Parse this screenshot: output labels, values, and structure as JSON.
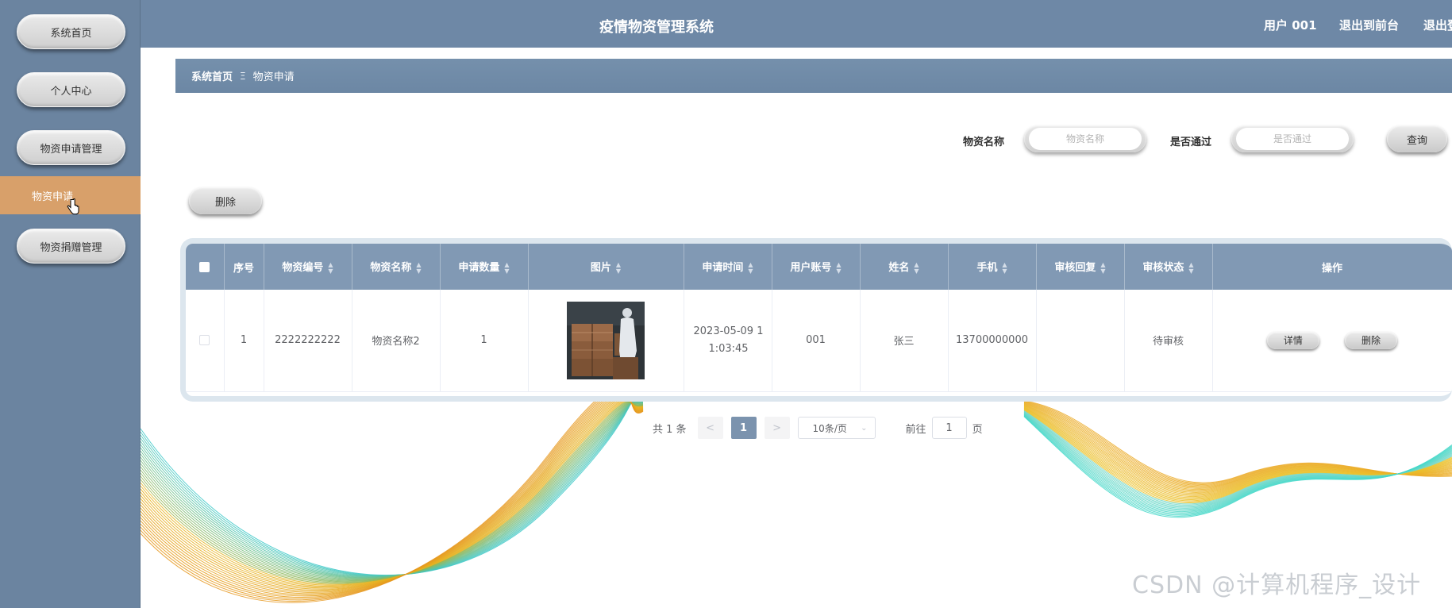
{
  "sidebar": {
    "items": [
      {
        "label": "系统首页"
      },
      {
        "label": "个人中心"
      },
      {
        "label": "物资申请管理"
      },
      {
        "label": "物资申请"
      },
      {
        "label": "物资捐赠管理"
      }
    ]
  },
  "header": {
    "title": "疫情物资管理系统",
    "user": "用户 001",
    "back_to_front": "退出到前台",
    "exit": "退出登录"
  },
  "breadcrumb": {
    "home": "系统首页",
    "separator": "Ξ",
    "current": "物资申请"
  },
  "search": {
    "name_label": "物资名称",
    "name_placeholder": "物资名称",
    "passed_label": "是否通过",
    "passed_placeholder": "是否通过",
    "query_button": "查询"
  },
  "toolbar": {
    "delete_button": "删除"
  },
  "table": {
    "columns": [
      "序号",
      "物资编号",
      "物资名称",
      "申请数量",
      "图片",
      "申请时间",
      "用户账号",
      "姓名",
      "手机",
      "审核回复",
      "审核状态",
      "操作"
    ],
    "rows": [
      {
        "index": "1",
        "code": "2222222222",
        "name": "物资名称2",
        "quantity": "1",
        "time": "2023-05-09 11:03:45",
        "account": "001",
        "person": "张三",
        "phone": "13700000000",
        "reply": "",
        "status": "待审核",
        "detail_button": "详情",
        "delete_button": "删除"
      }
    ]
  },
  "pagination": {
    "total": "共 1 条",
    "prev": "<",
    "current_page": "1",
    "next": ">",
    "page_size": "10条/页",
    "goto_label": "前往",
    "goto_value": "1",
    "goto_suffix": "页"
  },
  "watermark": "CSDN @计算机程序_设计",
  "colors": {
    "sidebar": "#6b84a0",
    "topbar": "#6e88a6",
    "active_item": "#d8a06a",
    "table_header": "#8199b4"
  }
}
